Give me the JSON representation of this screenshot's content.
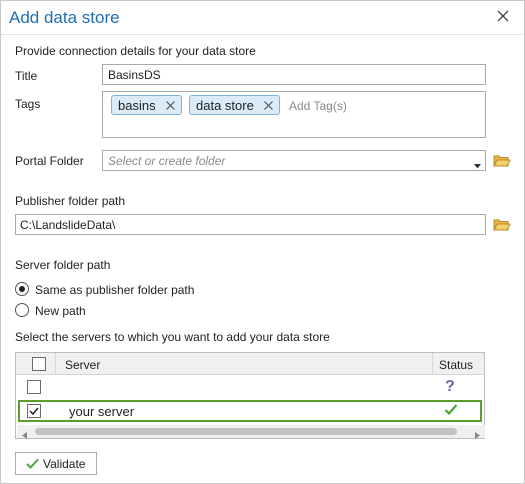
{
  "dialog": {
    "title": "Add data store",
    "subtitle": "Provide connection details for your data store",
    "close_icon": "close-icon"
  },
  "form": {
    "title_label": "Title",
    "title_value": "BasinsDS",
    "tags_label": "Tags",
    "tags": [
      {
        "label": "basins"
      },
      {
        "label": "data store"
      }
    ],
    "add_tag_placeholder": "Add Tag(s)",
    "portal_folder_label": "Portal Folder",
    "portal_folder_placeholder": "Select or create folder",
    "publisher_path_label": "Publisher folder path",
    "publisher_path_value": "C:\\LandslideData\\",
    "server_path_label": "Server folder path",
    "radio_options": [
      {
        "label": "Same as publisher folder path",
        "selected": true
      },
      {
        "label": "New path",
        "selected": false
      }
    ]
  },
  "servers": {
    "prompt": "Select the servers to which you want to add your data store",
    "columns": {
      "server": "Server",
      "status": "Status"
    },
    "rows": [
      {
        "name": "",
        "checked": false,
        "status_icon": "question-icon"
      },
      {
        "name": "your server",
        "checked": true,
        "status_icon": "checkmark-icon"
      }
    ]
  },
  "actions": {
    "validate_label": "Validate"
  },
  "colors": {
    "title": "#1f6fb5",
    "highlight": "#5c9e2e",
    "check": "#4aa33a",
    "question": "#7b5fa8",
    "folder": "#e6b54a"
  }
}
